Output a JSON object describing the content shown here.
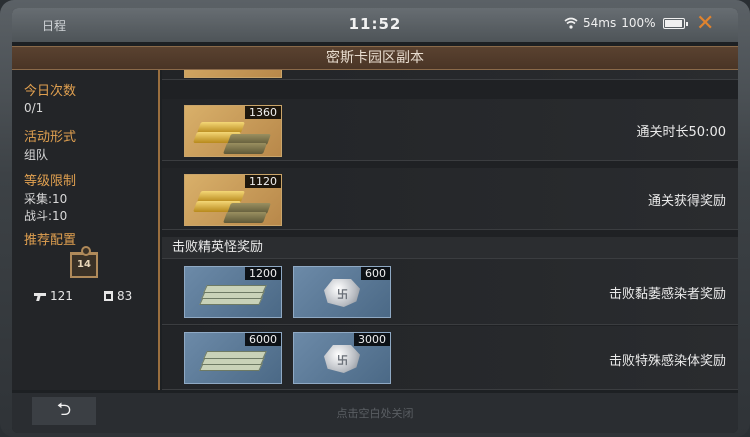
{
  "status": {
    "app_label": "日程",
    "time": "11:52",
    "ping": "54ms",
    "battery": "100%",
    "close_icon": "close-icon"
  },
  "title": "密斯卡园区副本",
  "left": {
    "daily_label": "今日次数",
    "daily_value": "0/1",
    "mode_label": "活动形式",
    "mode_value": "组队",
    "level_label": "等级限制",
    "level_gather": "采集:10",
    "level_combat": "战斗:10",
    "recommend_label": "推荐配置",
    "rank": "14",
    "attack": "121",
    "defense": "83"
  },
  "rewards": {
    "clear_time_label": "通关时长50:00",
    "clear_time_qty": "1360",
    "clear_reward_label": "通关获得奖励",
    "clear_reward_qty": "1120",
    "elite_header": "击败精英怪奖励",
    "elite1_label": "击败黏萎感染者奖励",
    "elite1_cash": "1200",
    "elite1_coin": "600",
    "elite2_label": "击败特殊感染体奖励",
    "elite2_cash": "6000",
    "elite2_coin": "3000"
  },
  "bottom": {
    "back_icon": "back-arrow-icon",
    "hint": "点击空白处关闭"
  }
}
